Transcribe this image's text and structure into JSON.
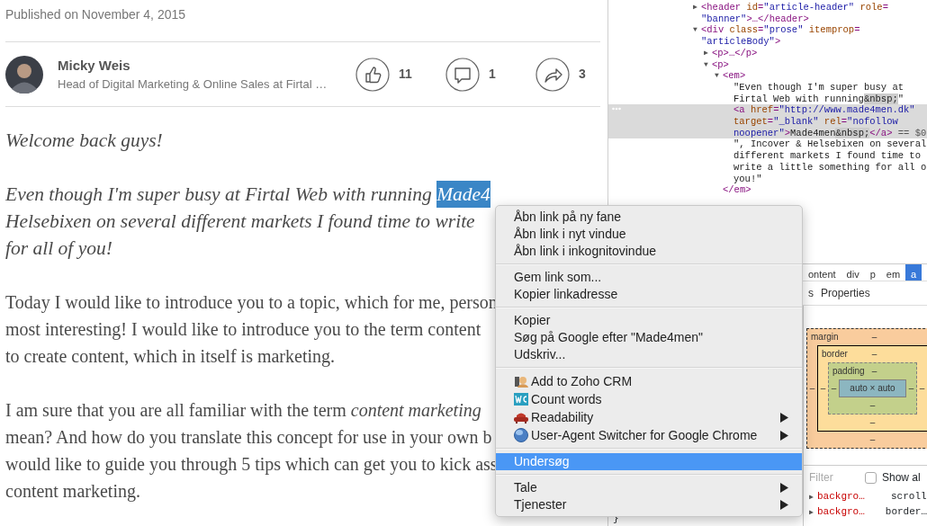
{
  "article": {
    "published": "Published on November 4, 2015",
    "author": {
      "name": "Micky Weis",
      "headline": "Head of Digital Marketing & Online Sales at Firtal …"
    },
    "stats": [
      {
        "kind": "like",
        "count": "11"
      },
      {
        "kind": "comment",
        "count": "1"
      },
      {
        "kind": "share",
        "count": "3"
      }
    ],
    "paragraphs": [
      {
        "italic": true,
        "lines": [
          {
            "text": "Welcome back guys!"
          }
        ]
      },
      {
        "italic": true,
        "lines": [
          {
            "text": "Even though I'm super busy at Firtal Web with running ",
            "selection": "Made4"
          },
          {
            "text": "Helsebixen on several different markets I found time to write"
          },
          {
            "text": "for all of you!"
          }
        ]
      },
      {
        "italic": false,
        "lines": [
          {
            "text": "Today I would like to introduce you to a topic, which for me, person"
          },
          {
            "text": "most interesting! I would like to introduce you to the term content"
          },
          {
            "text": "to create content, which in itself is marketing."
          }
        ]
      },
      {
        "italic": false,
        "lines": [
          {
            "text": "I am sure that you are all familiar with the term *content marketing*"
          },
          {
            "text": "mean? And how do you translate this concept for use in your own b"
          },
          {
            "text": "would like to guide you through 5 tips which can get you to kick ass"
          },
          {
            "text": "content marketing."
          }
        ]
      }
    ]
  },
  "devtools": {
    "elements_tree": [
      {
        "toggle": "▶",
        "selected": false,
        "lines": [
          [
            {
              "kind": "tag",
              "text": "<header"
            },
            {
              "kind": "attr",
              "text": " id"
            },
            {
              "kind": "tag",
              "text": "="
            },
            {
              "kind": "value",
              "text": "\"article-header\""
            },
            {
              "kind": "attr",
              "text": " role"
            },
            {
              "kind": "tag",
              "text": "="
            }
          ],
          [
            {
              "kind": "value",
              "text": "\"banner\""
            },
            {
              "kind": "tag",
              "text": ">…</header>"
            }
          ]
        ]
      },
      {
        "toggle": "▼",
        "selected": false,
        "lines": [
          [
            {
              "kind": "tag",
              "text": "<div"
            },
            {
              "kind": "attr",
              "text": " class"
            },
            {
              "kind": "tag",
              "text": "="
            },
            {
              "kind": "value",
              "text": "\"prose\""
            },
            {
              "kind": "attr",
              "text": " itemprop"
            },
            {
              "kind": "tag",
              "text": "="
            }
          ],
          [
            {
              "kind": "value",
              "text": "\"articleBody\""
            },
            {
              "kind": "tag",
              "text": ">"
            }
          ]
        ],
        "children": [
          {
            "toggle": "▶",
            "selected": false,
            "lines": [
              [
                {
                  "kind": "tag",
                  "text": "<p>…</p>"
                }
              ]
            ]
          },
          {
            "toggle": "▼",
            "selected": false,
            "lines": [
              [
                {
                  "kind": "tag",
                  "text": "<p>"
                }
              ]
            ],
            "children": [
              {
                "toggle": "▼",
                "selected": false,
                "lines": [
                  [
                    {
                      "kind": "tag",
                      "text": "<em>"
                    }
                  ]
                ],
                "children": [
                  {
                    "selected": false,
                    "lines": [
                      [
                        {
                          "kind": "text",
                          "text": "\"Even though I'm super busy at"
                        }
                      ],
                      [
                        {
                          "kind": "text",
                          "text": "Firtal Web with running"
                        },
                        {
                          "kind": "entity",
                          "text": "&nbsp;"
                        },
                        {
                          "kind": "text",
                          "text": "\""
                        }
                      ]
                    ]
                  },
                  {
                    "selected": true,
                    "lines": [
                      [
                        {
                          "kind": "tag",
                          "text": "<a"
                        },
                        {
                          "kind": "attr",
                          "text": " href"
                        },
                        {
                          "kind": "tag",
                          "text": "="
                        },
                        {
                          "kind": "value",
                          "text": "\"http://www.made4men.dk\""
                        }
                      ],
                      [
                        {
                          "kind": "attr",
                          "text": "target"
                        },
                        {
                          "kind": "tag",
                          "text": "="
                        },
                        {
                          "kind": "value",
                          "text": "\"_blank\""
                        },
                        {
                          "kind": "attr",
                          "text": " rel"
                        },
                        {
                          "kind": "tag",
                          "text": "="
                        },
                        {
                          "kind": "value",
                          "text": "\"nofollow"
                        }
                      ],
                      [
                        {
                          "kind": "value",
                          "text": "noopener\""
                        },
                        {
                          "kind": "tag",
                          "text": ">"
                        },
                        {
                          "kind": "text",
                          "text": "Made4men"
                        },
                        {
                          "kind": "entity",
                          "text": "&nbsp;"
                        },
                        {
                          "kind": "tag",
                          "text": "</a>"
                        },
                        {
                          "kind": "eq",
                          "text": " == $0"
                        }
                      ]
                    ]
                  },
                  {
                    "selected": false,
                    "lines": [
                      [
                        {
                          "kind": "text",
                          "text": "\", Incover & Helsebixen on several"
                        }
                      ],
                      [
                        {
                          "kind": "text",
                          "text": "different markets I found time to"
                        }
                      ],
                      [
                        {
                          "kind": "text",
                          "text": "write a little something for all o"
                        }
                      ],
                      [
                        {
                          "kind": "text",
                          "text": "you!\""
                        }
                      ]
                    ]
                  }
                ],
                "closing": [
                  {
                    "kind": "tag",
                    "text": "</em>"
                  }
                ]
              }
            ]
          }
        ]
      }
    ],
    "styles_fragment": "}",
    "breadcrumbs": [
      {
        "label": "ontent",
        "selected": false
      },
      {
        "label": "div",
        "selected": false
      },
      {
        "label": "p",
        "selected": false
      },
      {
        "label": "em",
        "selected": false
      },
      {
        "label": "a",
        "selected": true
      }
    ],
    "tabs": [
      {
        "label": "s",
        "selected": false
      },
      {
        "label": "Properties",
        "selected": false
      }
    ],
    "box_model": {
      "label": "margin",
      "top": "–",
      "left": "–",
      "inner": {
        "label": "border",
        "top": "–",
        "left": "–",
        "right": "–",
        "inner": {
          "label": "padding",
          "top": "–",
          "left": "–",
          "right": "–",
          "content": "auto × auto",
          "bottom": "–"
        },
        "bottom": "–"
      },
      "bottom": "–"
    },
    "filter": {
      "placeholder": "Filter",
      "show_all": {
        "label": "Show al",
        "checked": false
      }
    },
    "computed": [
      {
        "toggle": "▶",
        "name": "backgro…",
        "value": "scroll"
      },
      {
        "toggle": "▶",
        "name": "backgro…",
        "value": "border…"
      }
    ]
  },
  "context_menu": {
    "groups": [
      [
        {
          "label": "Åbn link på ny fane",
          "kind": "plain",
          "submenu": false,
          "selected": false
        },
        {
          "label": "Åbn link i nyt vindue",
          "kind": "plain",
          "submenu": false,
          "selected": false
        },
        {
          "label": "Åbn link i inkognitovindue",
          "kind": "plain",
          "submenu": false,
          "selected": false
        }
      ],
      [
        {
          "label": "Gem link som...",
          "kind": "plain",
          "submenu": false,
          "selected": false
        },
        {
          "label": "Kopier linkadresse",
          "kind": "plain",
          "submenu": false,
          "selected": false
        }
      ],
      [
        {
          "label": "Kopier",
          "kind": "plain",
          "submenu": false,
          "selected": false
        },
        {
          "label": "Søg på Google efter \"Made4men\"",
          "kind": "plain",
          "submenu": false,
          "selected": false
        },
        {
          "label": "Udskriv...",
          "kind": "plain",
          "submenu": false,
          "selected": false
        }
      ],
      [
        {
          "label": "Add to Zoho CRM",
          "kind": "person",
          "submenu": false,
          "selected": false
        },
        {
          "label": "Count words",
          "kind": "wc",
          "submenu": false,
          "selected": false
        },
        {
          "label": "Readability",
          "kind": "sofa",
          "submenu": true,
          "selected": false
        },
        {
          "label": "User-Agent Switcher for Google Chrome",
          "kind": "globe",
          "submenu": true,
          "selected": false
        }
      ],
      [
        {
          "label": "Undersøg",
          "kind": "plain",
          "submenu": false,
          "selected": true
        }
      ],
      [
        {
          "label": "Tale",
          "kind": "plain",
          "submenu": true,
          "selected": false
        },
        {
          "label": "Tjenester",
          "kind": "plain",
          "submenu": true,
          "selected": false
        }
      ]
    ]
  }
}
